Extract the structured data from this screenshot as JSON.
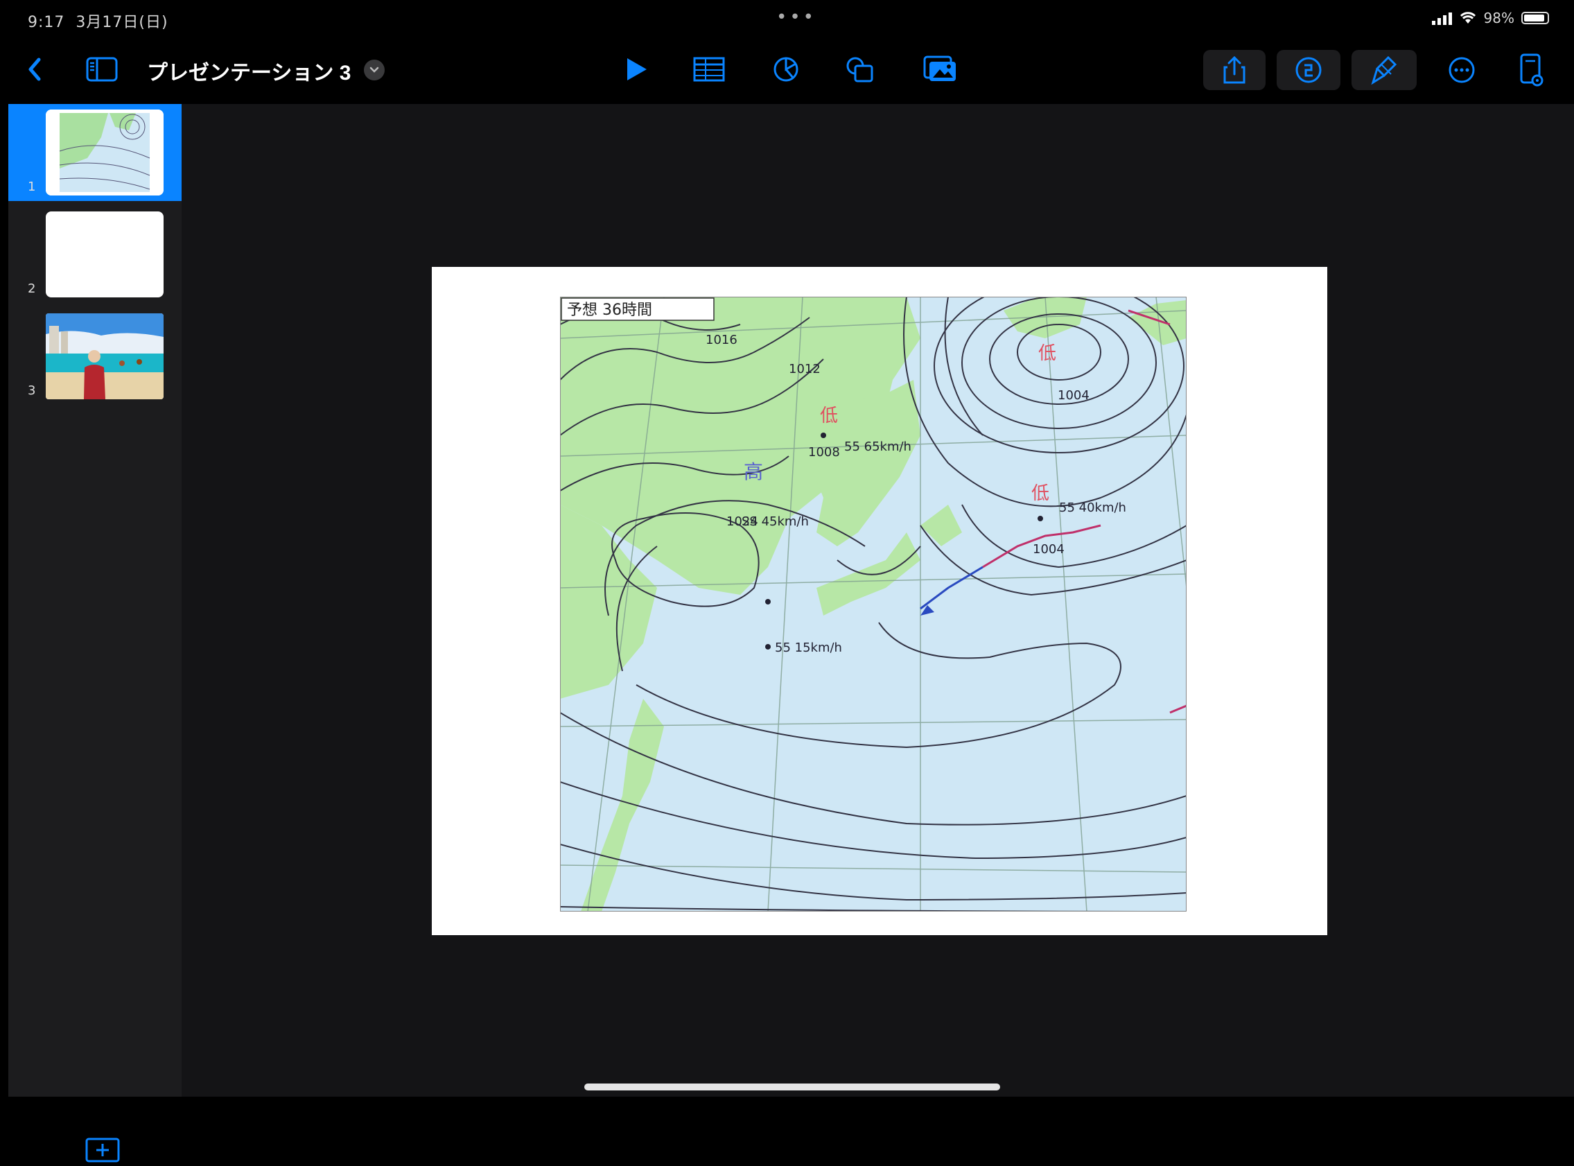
{
  "status_bar": {
    "time": "9:17",
    "date": "3月17日(日)",
    "battery_text": "98%"
  },
  "toolbar": {
    "document_title": "プレゼンテーション 3",
    "accent_color": "#0a84ff",
    "left_icons": [
      "back-chevron-icon",
      "sidebar-toggle-icon",
      "title-menu-chevron-icon"
    ],
    "center_icons": [
      "play-icon",
      "table-icon",
      "chart-icon",
      "shape-icon",
      "media-icon"
    ],
    "right_icons": [
      "share-icon",
      "collaborate-icon",
      "format-brush-icon",
      "more-icon",
      "document-setup-icon"
    ]
  },
  "sidebar": {
    "slides": [
      {
        "number": "1",
        "selected": true,
        "content": "weather-map"
      },
      {
        "number": "2",
        "selected": false,
        "content": "blank"
      },
      {
        "number": "3",
        "selected": false,
        "content": "beach-photo"
      }
    ],
    "add_slide_icon": "add-slide-icon"
  },
  "slide": {
    "map_header": "予想 36時間",
    "pressure_labels": [
      "1024",
      "1004",
      "1008",
      "1016",
      "1004",
      "1012"
    ],
    "speed_labels": [
      "55 65km/h",
      "55 40km/h",
      "55 15km/h",
      "SS 45km/h"
    ],
    "symbols": [
      "高",
      "低",
      "低",
      "低"
    ]
  }
}
